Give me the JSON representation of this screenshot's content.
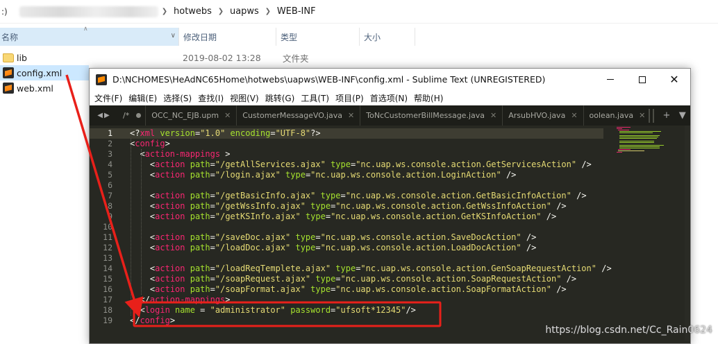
{
  "explorer": {
    "address_lead": ":)",
    "breadcrumb": [
      "hotwebs",
      "uapws",
      "WEB-INF"
    ],
    "columns": {
      "name": "名称",
      "date": "修改日期",
      "type": "类型",
      "size": "大小"
    },
    "files": [
      {
        "name": "lib",
        "date": "2019-08-02 13:28",
        "type": "文件夹",
        "icon": "folder-icon"
      },
      {
        "name": "config.xml",
        "date": "",
        "type": "",
        "icon": "sublime-file-icon"
      },
      {
        "name": "web.xml",
        "date": "",
        "type": "",
        "icon": "sublime-file-icon"
      }
    ]
  },
  "sublime": {
    "title": "D:\\NCHOMES\\HeAdNC65Home\\hotwebs\\uapws\\WEB-INF\\config.xml - Sublime Text (UNREGISTERED)",
    "menu": [
      "文件(F)",
      "编辑(E)",
      "选择(S)",
      "查找(I)",
      "视图(V)",
      "跳转(G)",
      "工具(T)",
      "项目(P)",
      "首选项(N)",
      "帮助(H)"
    ],
    "tabs": [
      {
        "label": "/*"
      },
      {
        "label": "OCC_NC_EJB.upm"
      },
      {
        "label": "CustomerMessageVO.java"
      },
      {
        "label": "ToNcCustomerBillMessage.java"
      },
      {
        "label": "ArsubHVO.java"
      },
      {
        "label": "oolean.java"
      }
    ],
    "line_numbers": [
      "1",
      "2",
      "3",
      "4",
      "5",
      "6",
      "7",
      "8",
      "9",
      "10",
      "11",
      "12",
      "13",
      "14",
      "15",
      "16",
      "17",
      "18",
      "19"
    ],
    "code_lines": [
      "<?xml version=\"1.0\" encoding=\"UTF-8\"?>",
      "<config>",
      "  <action-mappings >",
      "    <action path=\"/getAllServices.ajax\" type=\"nc.uap.ws.console.action.GetServicesAction\" />",
      "    <action path=\"/login.ajax\" type=\"nc.uap.ws.console.action.LoginAction\" />",
      "",
      "    <action path=\"/getBasicInfo.ajax\" type=\"nc.uap.ws.console.action.GetBasicInfoAction\" />",
      "    <action path=\"/getWssInfo.ajax\" type=\"nc.uap.ws.console.action.GetWssInfoAction\" />",
      "    <action path=\"/getKSInfo.ajax\" type=\"nc.uap.ws.console.action.GetKSInfoAction\" />",
      "",
      "    <action path=\"/saveDoc.ajax\" type=\"nc.uap.ws.console.action.SaveDocAction\" />",
      "    <action path=\"/loadDoc.ajax\" type=\"nc.uap.ws.console.action.LoadDocAction\" />",
      "",
      "    <action path=\"/loadReqTemplete.ajax\" type=\"nc.uap.ws.console.action.GenSoapRequestAction\" />",
      "    <action path=\"/soapRequest.ajax\" type=\"nc.uap.ws.console.action.SoapRequestAction\" />",
      "    <action path=\"/soapFormat.ajax\" type=\"nc.uap.ws.console.action.SoapFormatAction\" />",
      "  </action-mappings>",
      "  <login name = \"administrator\" password=\"ufsoft*12345\"/>",
      "</config>"
    ]
  },
  "annotation": {
    "color": "#e8201a"
  },
  "watermark": "https://blog.csdn.net/Cc_Rain0624"
}
